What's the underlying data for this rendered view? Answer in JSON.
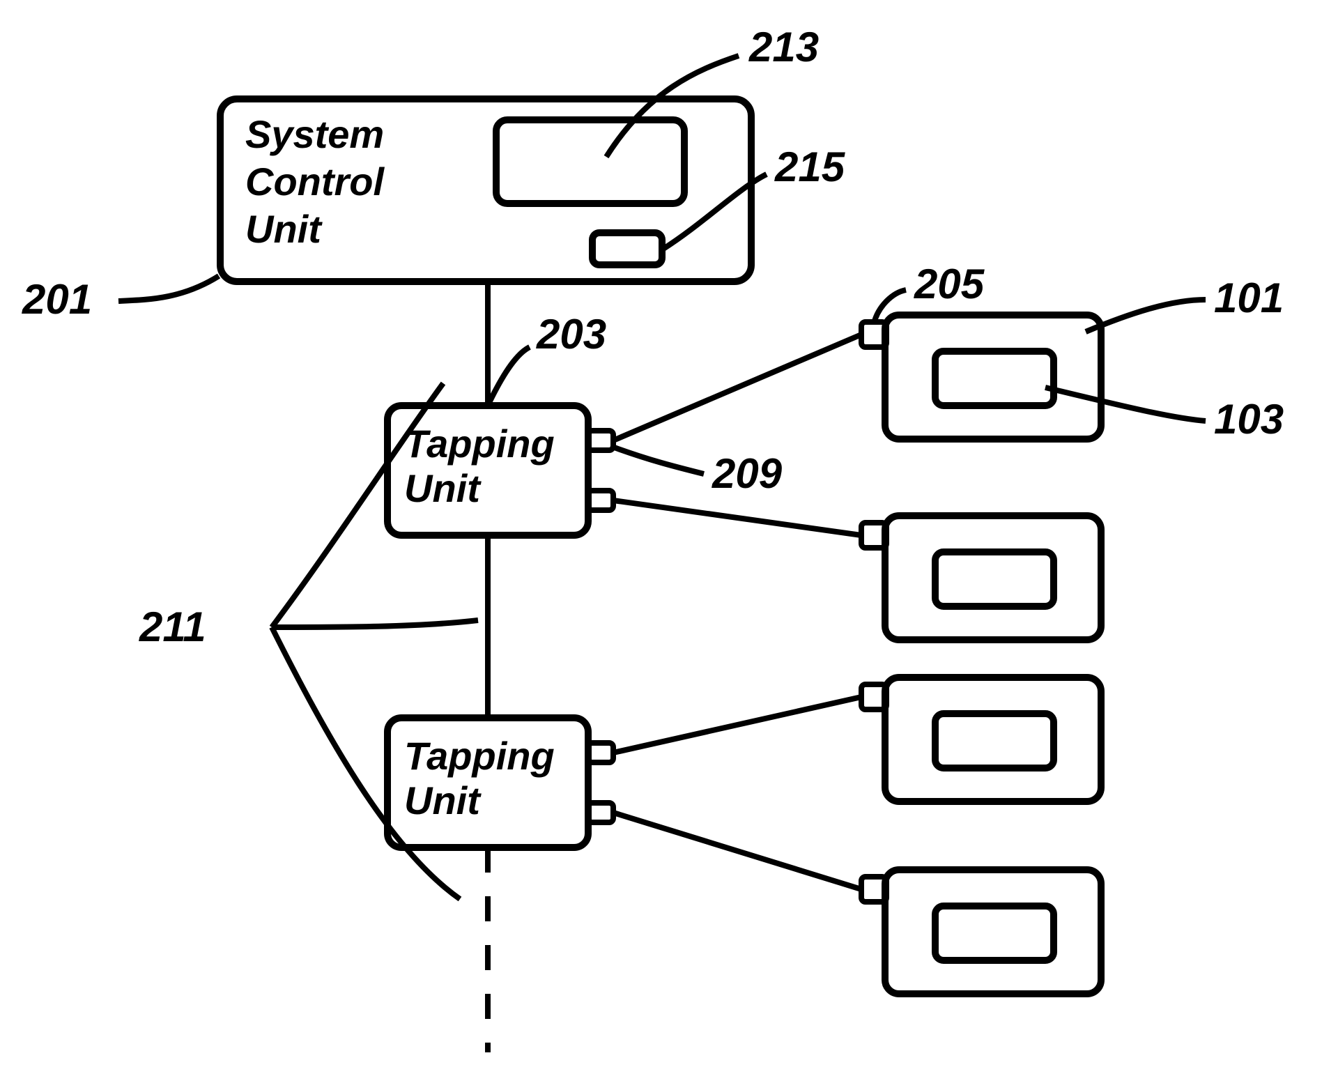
{
  "chart_data": {
    "type": "block-diagram",
    "blocks": [
      {
        "id": "system_control_unit",
        "ref": "201",
        "sub_blocks": [
          "213",
          "215"
        ]
      },
      {
        "id": "tapping_unit_upper",
        "ref": "203",
        "ports": [
          "209"
        ]
      },
      {
        "id": "tapping_unit_lower"
      },
      {
        "id": "device_1",
        "ref": "101",
        "connector_ref": "205",
        "inner_ref": "103"
      },
      {
        "id": "device_2"
      },
      {
        "id": "device_3"
      },
      {
        "id": "device_4"
      }
    ],
    "connections": [
      {
        "from": "system_control_unit",
        "to": "tapping_unit_upper",
        "bus_ref": "211"
      },
      {
        "from": "tapping_unit_upper",
        "to": "tapping_unit_lower",
        "bus_ref": "211"
      },
      {
        "from": "tapping_unit_lower",
        "to": "continuation",
        "bus_ref": "211"
      },
      {
        "from": "tapping_unit_upper",
        "to": "device_1"
      },
      {
        "from": "tapping_unit_upper",
        "to": "device_2"
      },
      {
        "from": "tapping_unit_lower",
        "to": "device_3"
      },
      {
        "from": "tapping_unit_lower",
        "to": "device_4"
      }
    ]
  },
  "labels": {
    "scu_line1": "System",
    "scu_line2": "Control",
    "scu_line3": "Unit",
    "tapping_line1": "Tapping",
    "tapping_line2": "Unit"
  },
  "refs": {
    "r201": "201",
    "r203": "203",
    "r205": "205",
    "r209": "209",
    "r211": "211",
    "r213": "213",
    "r215": "215",
    "r101": "101",
    "r103": "103"
  }
}
